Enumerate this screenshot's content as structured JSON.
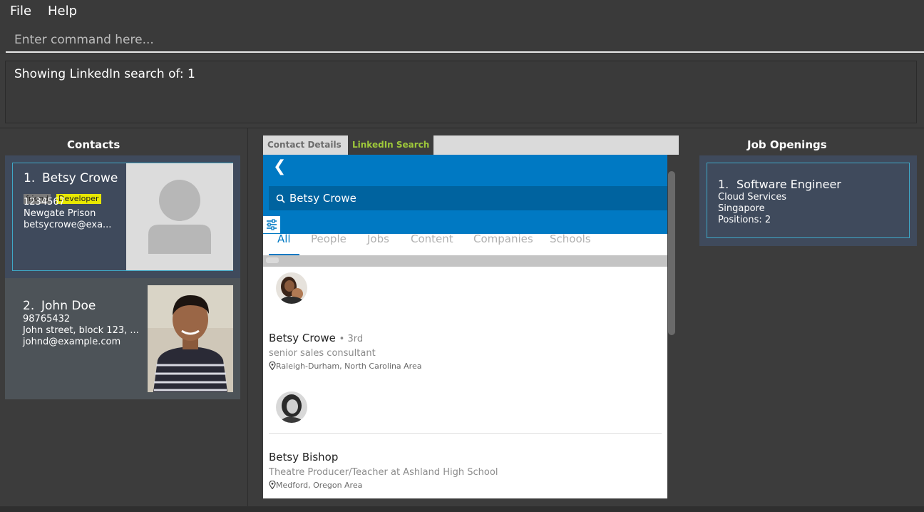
{
  "menu": {
    "file": "File",
    "help": "Help"
  },
  "command": {
    "placeholder": "Enter command here...",
    "value": ""
  },
  "result": {
    "text": "Showing LinkedIn search of: 1"
  },
  "contacts": {
    "title": "Contacts",
    "items": [
      {
        "index": "1.",
        "name": "Betsy Crowe",
        "tags": [
          "friend",
          "Developer"
        ],
        "phone": "1234567",
        "address": "Newgate Prison",
        "email": "betsycrowe@exa..."
      },
      {
        "index": "2.",
        "name": "John Doe",
        "tags": [],
        "phone": "98765432",
        "address": "John street, block 123, ...",
        "email": "johnd@example.com"
      }
    ]
  },
  "browser": {
    "tabs": [
      "Contact Details",
      "LinkedIn Search"
    ],
    "active_tab": "LinkedIn Search",
    "search_text": "Betsy Crowe",
    "li_tabs": [
      "All",
      "People",
      "Jobs",
      "Content",
      "Companies",
      "Schools"
    ],
    "active_li_tab": "All",
    "results": [
      {
        "name": "Betsy Crowe",
        "degree": "• 3rd",
        "title": "senior sales consultant",
        "location": "Raleigh-Durham, North Carolina Area"
      },
      {
        "name": "Betsy Bishop",
        "degree": "",
        "title": "Theatre Producer/Teacher at Ashland High School",
        "location": "Medford, Oregon Area"
      }
    ]
  },
  "jobs": {
    "title": "Job Openings",
    "items": [
      {
        "index": "1.",
        "title": "Software Engineer",
        "company": "Cloud Services",
        "location": "Singapore",
        "positions": "Positions: 2"
      }
    ]
  },
  "colors": {
    "linkedin_blue": "#0079c3",
    "card_selected": "#3f4a5c",
    "card_border": "#3fa7c6",
    "tab_active_text": "#9ec83a",
    "tag_developer": "#e8e800"
  }
}
